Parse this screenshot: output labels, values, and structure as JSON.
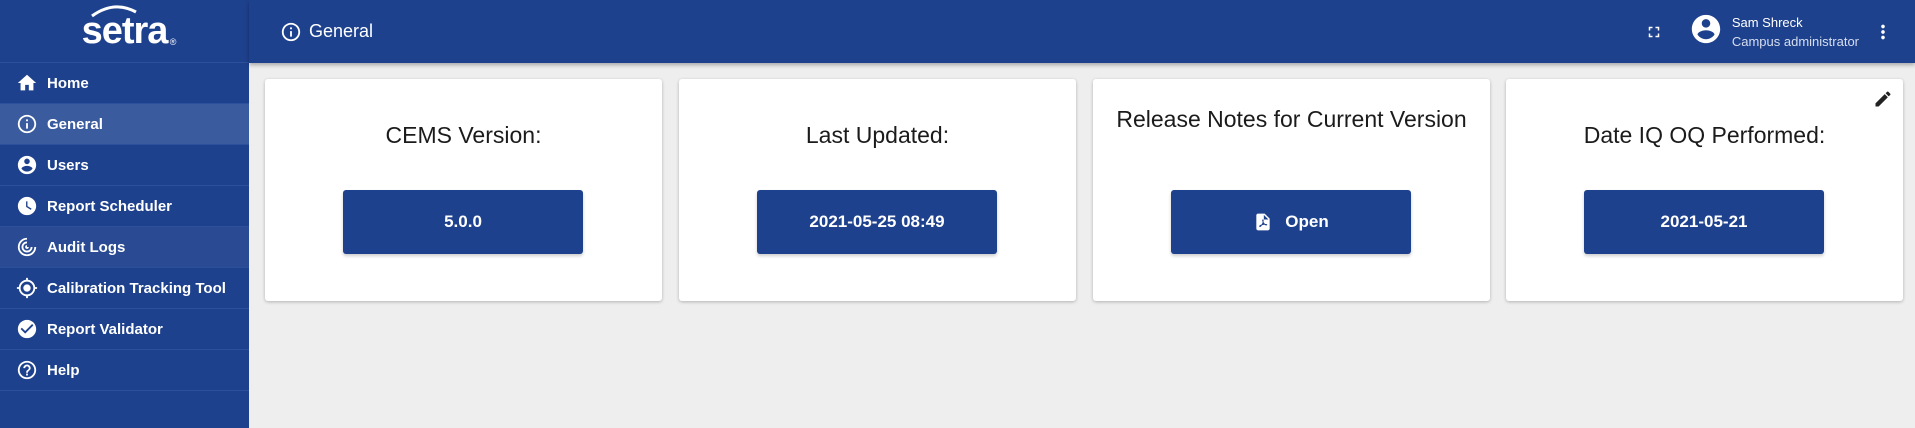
{
  "brand": {
    "logo": "setra",
    "registered": "®"
  },
  "sidebar": {
    "items": [
      {
        "label": "Home",
        "icon": "home-icon"
      },
      {
        "label": "General",
        "icon": "info-icon",
        "active": true
      },
      {
        "label": "Users",
        "icon": "user-circle-icon"
      },
      {
        "label": "Report Scheduler",
        "icon": "clock-icon"
      },
      {
        "label": "Audit Logs",
        "icon": "audit-icon"
      },
      {
        "label": "Calibration Tracking Tool",
        "icon": "crosshair-icon"
      },
      {
        "label": "Report Validator",
        "icon": "check-circle-icon"
      },
      {
        "label": "Help",
        "icon": "help-icon"
      }
    ]
  },
  "header": {
    "title": "General",
    "user": {
      "name": "Sam Shreck",
      "role": "Campus administrator"
    }
  },
  "cards": [
    {
      "title": "CEMS Version:",
      "button": "5.0.0"
    },
    {
      "title": "Last Updated:",
      "button": "2021-05-25 08:49"
    },
    {
      "title": "Release Notes for Current Version",
      "button": "Open",
      "button_icon": "pdf-icon"
    },
    {
      "title": "Date IQ OQ Performed:",
      "button": "2021-05-21",
      "action_icon": "edit-icon"
    }
  ],
  "colors": {
    "primary": "#1e418d",
    "active_nav": "#3a5c9f",
    "background": "#eeeeee",
    "card": "#ffffff"
  }
}
